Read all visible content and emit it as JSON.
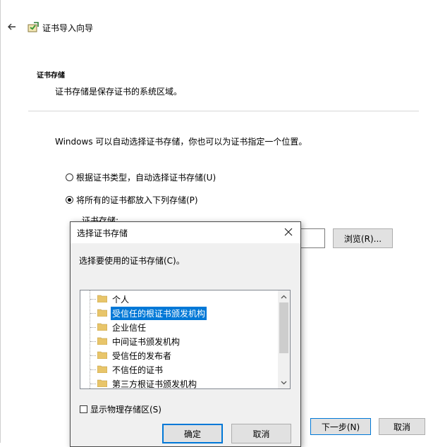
{
  "wizard": {
    "title": "证书导入向导",
    "section_heading": "证书存储",
    "section_description": "证书存储是保存证书的系统区域。",
    "intro": "Windows 可以自动选择证书存储，你也可以为证书指定一个位置。",
    "radio_auto_label": "根据证书类型，自动选择证书存储(U)",
    "radio_manual_label": "将所有的证书都放入下列存储(P)",
    "radio_selected": "manual",
    "store_label": "证书存储:",
    "store_value": "",
    "browse_label": "浏览(R)...",
    "next_label": "下一步(N)",
    "cancel_label": "取消"
  },
  "dialog": {
    "title": "选择证书存储",
    "prompt": "选择要使用的证书存储(C)。",
    "stores": [
      {
        "label": "个人",
        "selected": false
      },
      {
        "label": "受信任的根证书颁发机构",
        "selected": true
      },
      {
        "label": "企业信任",
        "selected": false
      },
      {
        "label": "中间证书颁发机构",
        "selected": false
      },
      {
        "label": "受信任的发布者",
        "selected": false
      },
      {
        "label": "不信任的证书",
        "selected": false
      },
      {
        "label": "第三方根证书颁发机构",
        "selected": false
      }
    ],
    "show_physical_label": "显示物理存储区(S)",
    "show_physical_checked": false,
    "ok_label": "确定",
    "cancel_label": "取消"
  },
  "colors": {
    "accent": "#0078d7",
    "folder": "#e8c56a",
    "button_face": "#e1e1e1",
    "dialog_bg": "#f0f0f0"
  },
  "icons": {
    "back": "back-arrow-icon",
    "wizard": "certificate-wizard-icon",
    "close": "close-icon",
    "folder": "folder-icon",
    "scroll_up": "chevron-up-icon",
    "scroll_down": "chevron-down-icon"
  }
}
